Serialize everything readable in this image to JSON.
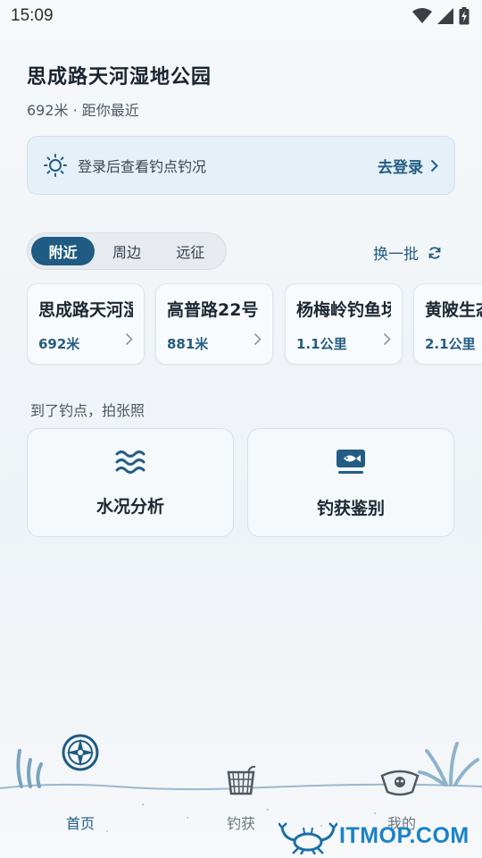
{
  "status": {
    "time": "15:09"
  },
  "header": {
    "place_name": "思成路天河湿地公园",
    "place_sub": "692米 · 距你最近"
  },
  "login_banner": {
    "text": "登录后查看钓点钓况",
    "link": "去登录"
  },
  "tabs": [
    {
      "label": "附近",
      "active": true
    },
    {
      "label": "周边",
      "active": false
    },
    {
      "label": "远征",
      "active": false
    }
  ],
  "refresh_label": "换一批",
  "spots": [
    {
      "name": "思成路天河湿地公园",
      "distance": "692米"
    },
    {
      "name": "高普路22号",
      "distance": "881米"
    },
    {
      "name": "杨梅岭钓鱼场",
      "distance": "1.1公里"
    },
    {
      "name": "黄陂生态园",
      "distance": "2.1公里"
    }
  ],
  "section_label": "到了钓点，拍张照",
  "tools": [
    {
      "label": "水况分析",
      "icon": "water-waves-icon"
    },
    {
      "label": "钓获鉴别",
      "icon": "fish-id-icon"
    }
  ],
  "bottom_nav": [
    {
      "label": "首页",
      "icon": "compass-icon",
      "active": true
    },
    {
      "label": "钓获",
      "icon": "basket-icon",
      "active": false
    },
    {
      "label": "我的",
      "icon": "pirate-skull-icon",
      "active": false
    }
  ],
  "watermark": "ITMOP.COM",
  "colors": {
    "accent": "#1f5b82",
    "banner_bg": "#e6f0f8",
    "watermark": "#1a83c8"
  }
}
